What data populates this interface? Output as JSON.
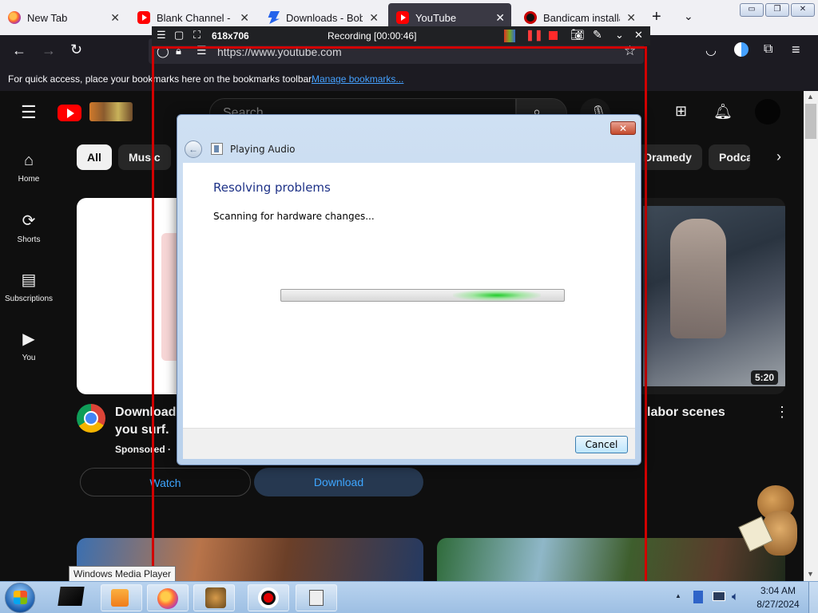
{
  "browser": {
    "tabs": [
      {
        "title": "New Tab",
        "favicon": "firefox-icon"
      },
      {
        "title": "Blank Channel - YouTube",
        "favicon": "youtube-icon"
      },
      {
        "title": "Downloads - Bob P",
        "favicon": "downloads-icon"
      },
      {
        "title": "YouTube",
        "favicon": "youtube-icon",
        "active": true
      },
      {
        "title": "Bandicam installation",
        "favicon": "bandicam-icon"
      }
    ],
    "new_tab_label": "+",
    "url": "https://www.youtube.com",
    "bookmarks_hint": "For quick access, place your bookmarks here on the bookmarks toolbar.",
    "manage_bookmarks": "Manage bookmarks..."
  },
  "recorder": {
    "size": "618x706",
    "status": "Recording [00:00:46]",
    "frame_color": "#d10000"
  },
  "youtube": {
    "search_placeholder": "Search",
    "sidebar": [
      {
        "label": "Home",
        "icon": "home-icon"
      },
      {
        "label": "Shorts",
        "icon": "shorts-icon"
      },
      {
        "label": "Subscriptions",
        "icon": "subscriptions-icon"
      },
      {
        "label": "You",
        "icon": "you-icon"
      }
    ],
    "chips": [
      "All",
      "Music",
      "Dramedy",
      "Podcasts"
    ],
    "ad": {
      "title_line1": "Download",
      "title_line2": "you surf.",
      "sponsored": "Sponsored · ",
      "watch_label": "Watch",
      "download_label": "Download"
    },
    "video": {
      "duration": "5:20",
      "title": "labor scenes"
    },
    "accent": "#ff0000"
  },
  "dialog": {
    "title": "Playing Audio",
    "heading": "Resolving problems",
    "status": "Scanning for hardware changes...",
    "cancel_label": "Cancel",
    "close_label": "✕"
  },
  "taskbar": {
    "tooltip": "Windows Media Player",
    "time": "3:04 AM",
    "date": "8/27/2024",
    "overflow_label": "▲"
  }
}
